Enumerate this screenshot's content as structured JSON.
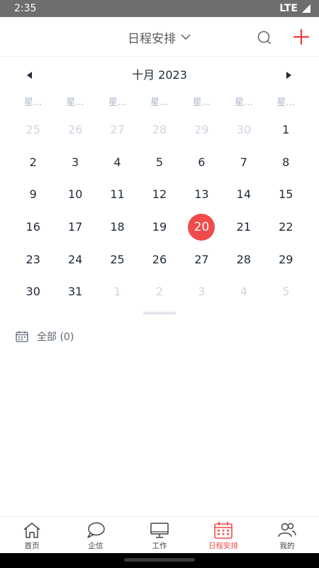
{
  "status_bar": {
    "time": "2:35",
    "network": "LTE"
  },
  "header": {
    "title": "日程安排",
    "title_icon": "chevron-down-icon",
    "search_icon": "search-icon",
    "add_icon": "plus-icon"
  },
  "calendar": {
    "month_label": "十月 2023",
    "weekdays": [
      "星...",
      "星...",
      "星...",
      "星...",
      "星...",
      "星...",
      "星..."
    ],
    "days": [
      {
        "label": "25",
        "muted": true
      },
      {
        "label": "26",
        "muted": true
      },
      {
        "label": "27",
        "muted": true
      },
      {
        "label": "28",
        "muted": true
      },
      {
        "label": "29",
        "muted": true
      },
      {
        "label": "30",
        "muted": true
      },
      {
        "label": "1",
        "muted": false
      },
      {
        "label": "2",
        "muted": false
      },
      {
        "label": "3",
        "muted": false
      },
      {
        "label": "4",
        "muted": false
      },
      {
        "label": "5",
        "muted": false
      },
      {
        "label": "6",
        "muted": false
      },
      {
        "label": "7",
        "muted": false
      },
      {
        "label": "8",
        "muted": false
      },
      {
        "label": "9",
        "muted": false
      },
      {
        "label": "10",
        "muted": false
      },
      {
        "label": "11",
        "muted": false
      },
      {
        "label": "12",
        "muted": false
      },
      {
        "label": "13",
        "muted": false
      },
      {
        "label": "14",
        "muted": false
      },
      {
        "label": "15",
        "muted": false
      },
      {
        "label": "16",
        "muted": false
      },
      {
        "label": "17",
        "muted": false
      },
      {
        "label": "18",
        "muted": false
      },
      {
        "label": "19",
        "muted": false
      },
      {
        "label": "20",
        "muted": false,
        "today": true
      },
      {
        "label": "21",
        "muted": false
      },
      {
        "label": "22",
        "muted": false
      },
      {
        "label": "23",
        "muted": false
      },
      {
        "label": "24",
        "muted": false
      },
      {
        "label": "25",
        "muted": false
      },
      {
        "label": "26",
        "muted": false
      },
      {
        "label": "27",
        "muted": false
      },
      {
        "label": "28",
        "muted": false
      },
      {
        "label": "29",
        "muted": false
      },
      {
        "label": "30",
        "muted": false
      },
      {
        "label": "31",
        "muted": false
      },
      {
        "label": "1",
        "muted": true
      },
      {
        "label": "2",
        "muted": true
      },
      {
        "label": "3",
        "muted": true
      },
      {
        "label": "4",
        "muted": true
      },
      {
        "label": "5",
        "muted": true
      }
    ]
  },
  "filter": {
    "label": "全部 (0)",
    "icon": "calendar-icon"
  },
  "bottom_nav": {
    "items": [
      {
        "label": "首页",
        "icon": "home-icon"
      },
      {
        "label": "企信",
        "icon": "chat-bubble-icon"
      },
      {
        "label": "工作",
        "icon": "monitor-icon"
      },
      {
        "label": "日程安排",
        "icon": "calendar-icon",
        "active": true
      },
      {
        "label": "我的",
        "icon": "people-icon"
      }
    ]
  },
  "colors": {
    "accent": "#ef4b4b",
    "text": "#1f2a36",
    "muted": "#cdd6e0",
    "weekday": "#aab6c6"
  }
}
